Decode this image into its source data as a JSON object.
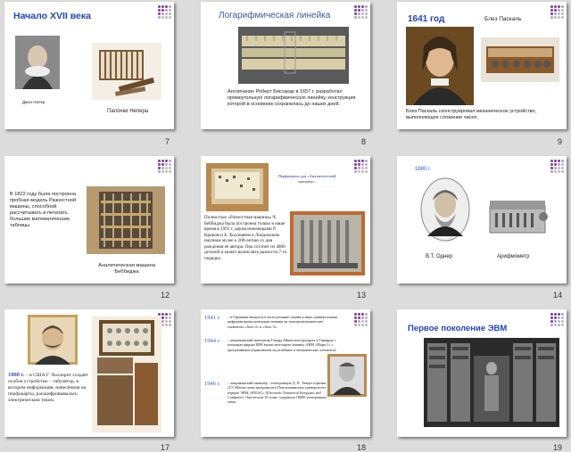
{
  "slides": [
    {
      "num": "7",
      "title": "Начало XVII века",
      "caption_portrait": "Джон Непер",
      "caption_device": "Палочки Непера"
    },
    {
      "num": "8",
      "title": "Логарифмическая линейка",
      "text": "Англичанин Роберт Биссакар в 1657 г. разработал прямоугольную логарифмическую линейку, конструкция которой в основном сохранилась до наших дней."
    },
    {
      "num": "9",
      "year": "1641 год",
      "name": "Блез Паскаль",
      "text": "Блез Паскаль сконструировал механическое устройство, выполняющее сложение чисел."
    },
    {
      "num": "12",
      "text": "В 1822 году была построена пробная модель Разностной машины, способной рассчитывать и печатать большие математические таблицы",
      "caption": "Аналитическая машина Беббиджа"
    },
    {
      "num": "13",
      "caption_top": "Перфокарты для «Аналитической машины».",
      "text": "Полностью «Разностная машина» Ч. Беббиджа была построена только в наше время в 1991 г. двумя инженерами Р. Криком и Б. Холловеем в Лондонском научном музее к 200-летию со дня рождения её автора. Она состоит из 4000 деталей и может вычислять разности 7-го порядка."
    },
    {
      "num": "14",
      "year": "1880 г.",
      "caption_left": "В.Т. Однер",
      "caption_right": "Арифмометр"
    },
    {
      "num": "17",
      "text": "1888 г. – в США Г. Холлерит создаёт особое устройство – табулятор, в котором информация, нанесённая на перфокарты, расшифровывалась электрическим током."
    },
    {
      "num": "18",
      "entries": [
        {
          "year": "1941 г.",
          "text": "– в Германии вводится в эксплуатацию первая в мире универсальная цифровая вычислительная машина на электромеханических элементах «Зенс-2» и «Зенс-3»."
        },
        {
          "year": "1944 г.",
          "text": "– американский математик Говард Айкен конструирует в Гарварде с помощью фирмы IBM вычислительную машину АВМ «Марк-1» с программным управлением на релейных и механических элементах."
        },
        {
          "year": "1946 г.",
          "text": "– американский инженер - электронщик Д. П. Эккерт и физик Д.У. Мочли сконструировали в Пенсильванском университете первую ЭВМ «ENIAC» (Electronic Numerical Integrator and Computer). Она весила 30 тонн, содержала 18000 электронных ламп."
        }
      ]
    },
    {
      "num": "19",
      "title": "Первое поколение ЭВМ"
    }
  ],
  "colors": {
    "title_blue": "#2244bb",
    "dot_purple": "#7a3d96",
    "year_blue": "#3355cc"
  }
}
